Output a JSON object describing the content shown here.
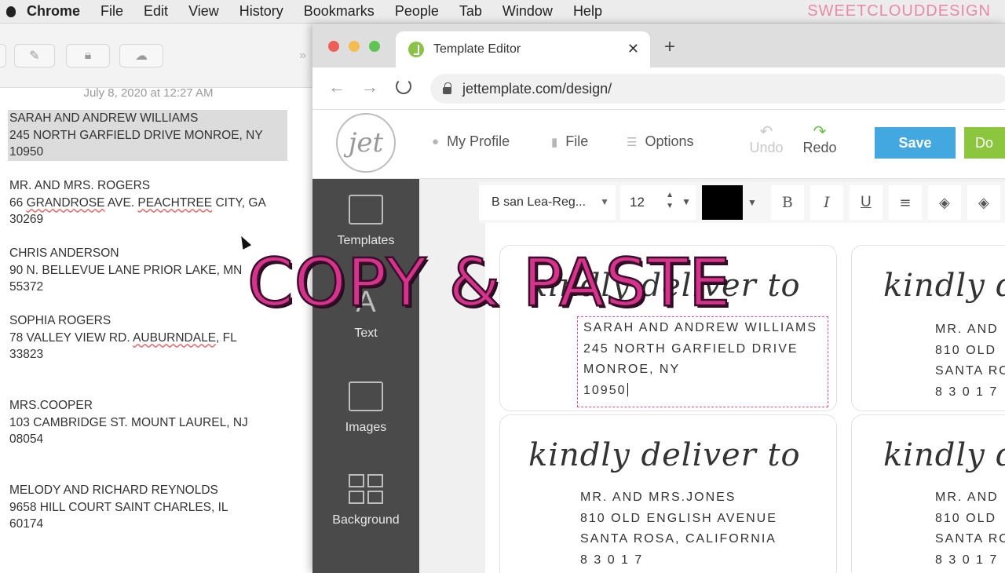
{
  "menubar": {
    "app": "Chrome",
    "items": [
      "File",
      "Edit",
      "View",
      "History",
      "Bookmarks",
      "People",
      "Tab",
      "Window",
      "Help"
    ],
    "brand": "SWEETCLOUDDESIGN"
  },
  "notes": {
    "date": "July 8, 2020 at 12:27 AM",
    "entries": [
      {
        "l1": "SARAH AND ANDREW WILLIAMS",
        "l2": "245 NORTH GARFIELD DRIVE MONROE, NY",
        "l3": "10950"
      },
      {
        "l1": "MR. AND MRS. ROGERS",
        "l2a": "66 ",
        "l2b": "GRANDROSE",
        "l2c": " AVE. ",
        "l2d": "PEACHTREE",
        "l2e": " CITY, GA",
        "l3": "30269"
      },
      {
        "l1": "CHRIS ANDERSON",
        "l2": "90 N. BELLEVUE LANE PRIOR LAKE, MN",
        "l3": "55372"
      },
      {
        "l1": "SOPHIA ROGERS",
        "l2a": "78 VALLEY VIEW RD. ",
        "l2b": "AUBURNDALE",
        "l2c": ", FL",
        "l3": "33823"
      },
      {
        "l1": "MRS.COOPER",
        "l2": "103 CAMBRIDGE ST. MOUNT LAUREL, NJ",
        "l3": "08054"
      },
      {
        "l1": "MELODY AND RICHARD REYNOLDS",
        "l2": "9658 HILL COURT SAINT CHARLES, IL",
        "l3": "60174"
      }
    ]
  },
  "browser": {
    "tab_title": "Template Editor",
    "url": "jettemplate.com/design/"
  },
  "editor": {
    "logo": "jet",
    "nav": {
      "profile": "My Profile",
      "file": "File",
      "options": "Options"
    },
    "undo": "Undo",
    "redo": "Redo",
    "save": "Save",
    "done": "Do",
    "sidebar": [
      "Templates",
      "Text",
      "Images",
      "Background"
    ],
    "toolbar": {
      "font": "B san Lea-Reg...",
      "size": "12",
      "bold": "B",
      "italic": "I",
      "underline": "U",
      "text_color": "#000000"
    },
    "labels": [
      {
        "script": "kindly deliver to",
        "l1": "SARAH AND ANDREW WILLIAMS",
        "l2": "245 NORTH GARFIELD DRIVE",
        "l3": "MONROE, NY",
        "l4": "10950"
      },
      {
        "script": "kindly deli",
        "l1": "MR. AND",
        "l2": "810 OLD",
        "l3": "SANTA RO",
        "l4": "8 3 0 1 7"
      },
      {
        "script": "kindly deliver to",
        "l1": "MR. AND MRS.JONES",
        "l2": "810 OLD ENGLISH AVENUE",
        "l3": "SANTA ROSA, CALIFORNIA",
        "l4": "8 3 0 1 7"
      },
      {
        "script": "kindly deli",
        "l1": "MR. AND",
        "l2": "810 OLD",
        "l3": "SANTA RO",
        "l4": "8 3 0 1 7"
      }
    ]
  },
  "overlay": "COPY & PASTE",
  "colors": {
    "accent_blue": "#43a8e0",
    "accent_green": "#8cc63f",
    "overlay_pink": "#d6338c",
    "edit_box": "#e4507b"
  }
}
